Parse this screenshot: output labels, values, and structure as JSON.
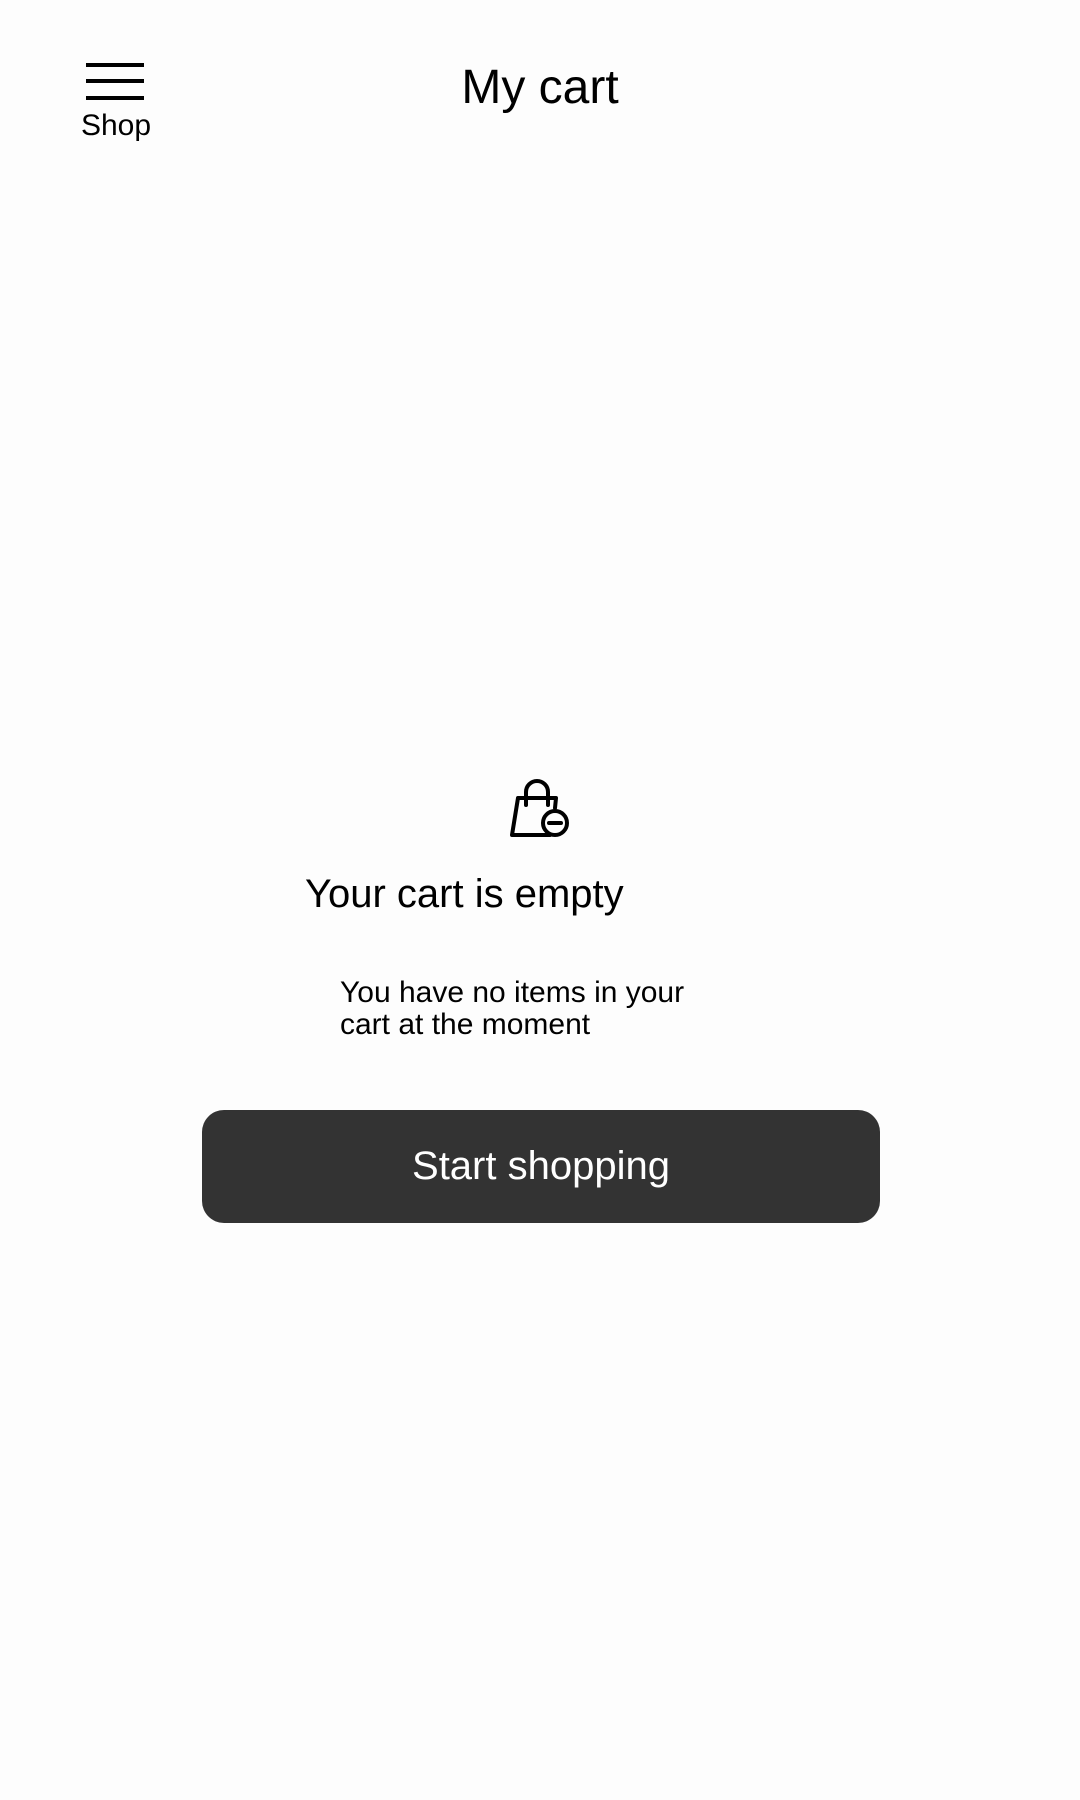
{
  "header": {
    "menu_label": "Shop",
    "menu_icon": "hamburger-icon",
    "title": "My cart"
  },
  "empty_state": {
    "icon": "shopping-bag-minus-icon",
    "heading": "Your cart is empty",
    "message": "You have no items in your cart at the moment",
    "button_label": "Start shopping"
  },
  "colors": {
    "background": "#fdfdfd",
    "button_background": "#333333",
    "button_text": "#ffffff",
    "text": "#000000"
  }
}
